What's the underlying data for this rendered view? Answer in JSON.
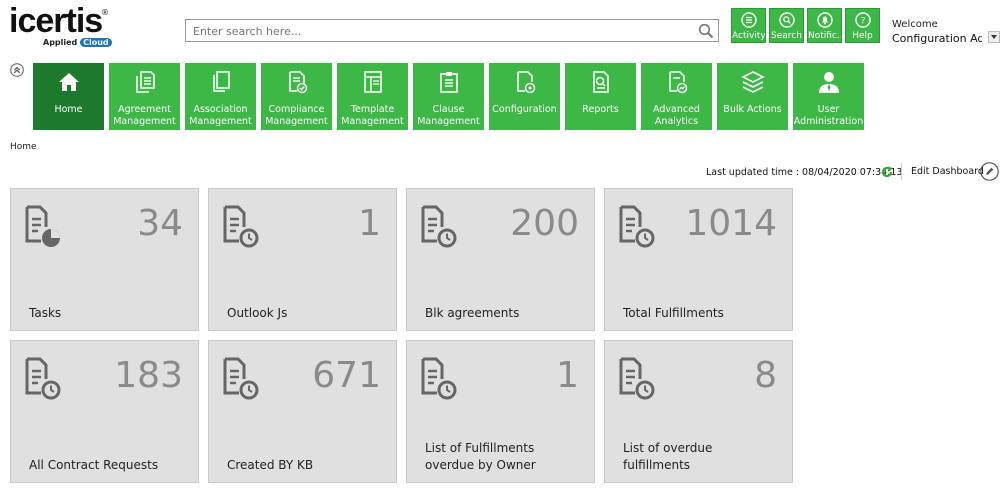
{
  "brand": {
    "name": "icertis",
    "reg": "®",
    "sub_prefix": "Applied",
    "sub_cloud": "Cloud"
  },
  "search": {
    "placeholder": "Enter search here..."
  },
  "toolbar": [
    {
      "id": "activity",
      "label": "Activity",
      "icon": "list-icon"
    },
    {
      "id": "search",
      "label": "Search",
      "icon": "search-icon"
    },
    {
      "id": "notifications",
      "label": "Notific...",
      "icon": "bell-icon"
    },
    {
      "id": "help",
      "label": "Help",
      "icon": "help-icon"
    }
  ],
  "user": {
    "welcome": "Welcome",
    "name": "Configuration Ad..."
  },
  "nav": [
    {
      "id": "home",
      "label": "Home",
      "active": true
    },
    {
      "id": "agreement",
      "label": "Agreement Management"
    },
    {
      "id": "association",
      "label": "Association Management"
    },
    {
      "id": "compliance",
      "label": "Compliance Management"
    },
    {
      "id": "template",
      "label": "Template Management"
    },
    {
      "id": "clause",
      "label": "Clause Management"
    },
    {
      "id": "configuration",
      "label": "Configuration"
    },
    {
      "id": "reports",
      "label": "Reports"
    },
    {
      "id": "analytics",
      "label": "Advanced Analytics"
    },
    {
      "id": "bulk",
      "label": "Bulk Actions"
    },
    {
      "id": "useradmin",
      "label": "User Administration"
    }
  ],
  "breadcrumb": "Home",
  "dashboard": {
    "updated_label": "Last updated time : 08/04/2020 07:34:13",
    "edit_label": "Edit Dashboard"
  },
  "tiles": [
    {
      "count": "34",
      "label": "Tasks",
      "icon": "document-chart-icon"
    },
    {
      "count": "1",
      "label": "Outlook Js",
      "icon": "document-clock-icon"
    },
    {
      "count": "200",
      "label": "Blk agreements",
      "icon": "document-clock-icon"
    },
    {
      "count": "1014",
      "label": "Total Fulfillments",
      "icon": "document-clock-icon"
    },
    {
      "count": "183",
      "label": "All Contract Requests",
      "icon": "document-clock-icon"
    },
    {
      "count": "671",
      "label": "Created BY KB",
      "icon": "document-clock-icon"
    },
    {
      "count": "1",
      "label": "List of Fulfillments overdue by Owner",
      "icon": "document-clock-icon"
    },
    {
      "count": "8",
      "label": "List of overdue fulfillments",
      "icon": "document-clock-icon"
    }
  ],
  "colors": {
    "accent": "#3db846",
    "active": "#1d7a2d",
    "tile": "#e0e0e0",
    "count": "#8a8a8a"
  }
}
